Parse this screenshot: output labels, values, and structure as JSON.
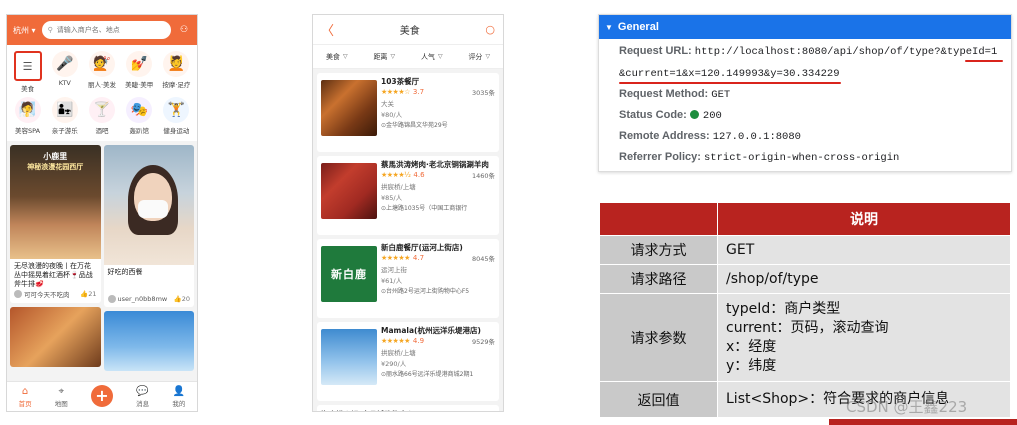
{
  "home": {
    "city": "杭州",
    "search_placeholder": "请输入商户名、地点",
    "categories": [
      {
        "label": "美食",
        "icon": "food-menu-icon",
        "glyph": "☰",
        "color": "#ffffff",
        "selected": true
      },
      {
        "label": "KTV",
        "icon": "microphone-icon",
        "glyph": "🎤",
        "color": "#fff4ee"
      },
      {
        "label": "丽人·美发",
        "icon": "hair-salon-icon",
        "glyph": "💇",
        "color": "#fff4ee"
      },
      {
        "label": "美睫·美甲",
        "icon": "nail-icon",
        "glyph": "💅",
        "color": "#fff4ee"
      },
      {
        "label": "按摩·足疗",
        "icon": "massage-icon",
        "glyph": "💆",
        "color": "#fff4ee"
      },
      {
        "label": "美容SPA",
        "icon": "spa-mask-icon",
        "glyph": "🧖",
        "color": "#fff0f5"
      },
      {
        "label": "亲子游乐",
        "icon": "family-icon",
        "glyph": "👨‍👧",
        "color": "#fff4ee"
      },
      {
        "label": "酒吧",
        "icon": "cocktail-icon",
        "glyph": "🍸",
        "color": "#fff0f5"
      },
      {
        "label": "轰趴馆",
        "icon": "party-mask-icon",
        "glyph": "🎭",
        "color": "#f5efff"
      },
      {
        "label": "健身运动",
        "icon": "dumbbell-icon",
        "glyph": "🏋",
        "color": "#eef6ff"
      }
    ],
    "feed": [
      {
        "overlay_title": "小鹿里",
        "overlay_sub": "神秘浪漫花园西厅",
        "title": "无尽浪漫的夜晚丨在万花丛中摇晃着红酒杯🍷品战斧牛排🥩",
        "user": "可可今天不吃肉",
        "likes": "21"
      },
      {
        "title": "好吃的西餐",
        "user": "user_n0bb8mw",
        "likes": "20"
      }
    ],
    "tabs": [
      {
        "label": "首页",
        "icon": "home-icon",
        "glyph": "⌂"
      },
      {
        "label": "地图",
        "icon": "map-pin-icon",
        "glyph": "⌖"
      },
      {
        "label": "",
        "icon": "plus-icon",
        "glyph": "+"
      },
      {
        "label": "消息",
        "icon": "message-icon",
        "glyph": "💬"
      },
      {
        "label": "我的",
        "icon": "profile-icon",
        "glyph": "👤"
      }
    ]
  },
  "food_list": {
    "title": "美食",
    "filters": [
      "美食",
      "距离",
      "人气",
      "评分"
    ],
    "shops": [
      {
        "name": "103茶餐厅",
        "stars": "★★★★☆",
        "score": "3.7",
        "comments": "3035条",
        "area": "大关",
        "price": "¥80/人",
        "address": "金华路锦昌文华苑29号"
      },
      {
        "name": "蔡馬洪涛烤肉·老北京铜锅涮羊肉",
        "stars": "★★★★½",
        "score": "4.6",
        "comments": "1460条",
        "area": "拱宸桥/上塘",
        "price": "¥85/人",
        "address": "上塘路1035号（中国工商银行"
      },
      {
        "name": "新白鹿餐厅(运河上街店)",
        "stars": "★★★★★",
        "score": "4.7",
        "comments": "8045条",
        "area": "运河上街",
        "price": "¥61/人",
        "address": "台州路2号运河上街购物中心F5",
        "logo_text": "新白鹿"
      },
      {
        "name": "Mamala(杭州远洋乐堤港店)",
        "stars": "★★★★★",
        "score": "4.9",
        "comments": "9529条",
        "area": "拱宸桥/上塘",
        "price": "¥290/人",
        "address": "丽水路66号远洋乐堤港商城2期1"
      },
      {
        "name": "海底捞火锅(水晶城购物中心"
      }
    ]
  },
  "request": {
    "section_title": "General",
    "rows": [
      {
        "key": "Request URL:",
        "value": "http://localhost:8080/api/shop/of/type?&typeId=1"
      },
      {
        "key": "",
        "value": "&current=1&x=120.149993&y=30.334229"
      },
      {
        "key": "Request Method:",
        "value": "GET"
      },
      {
        "key": "Status Code:",
        "value": "200"
      },
      {
        "key": "Remote Address:",
        "value": "127.0.0.1:8080"
      },
      {
        "key": "Referrer Policy:",
        "value": "strict-origin-when-cross-origin"
      }
    ],
    "status_color": "#1e8e3e"
  },
  "api_table": {
    "header": "说明",
    "rows": [
      {
        "key": "请求方式",
        "lines": [
          "GET"
        ]
      },
      {
        "key": "请求路径",
        "lines": [
          "/shop/of/type"
        ]
      },
      {
        "key": "请求参数",
        "lines": [
          "typeId：商户类型",
          "current：页码，滚动查询",
          "x：经度",
          "y：纬度"
        ]
      },
      {
        "key": "返回值",
        "lines": [
          "List<Shop>：符合要求的商户信息"
        ]
      }
    ],
    "accent_color": "#b8231f"
  },
  "watermark": "CSDN @王鑫223"
}
